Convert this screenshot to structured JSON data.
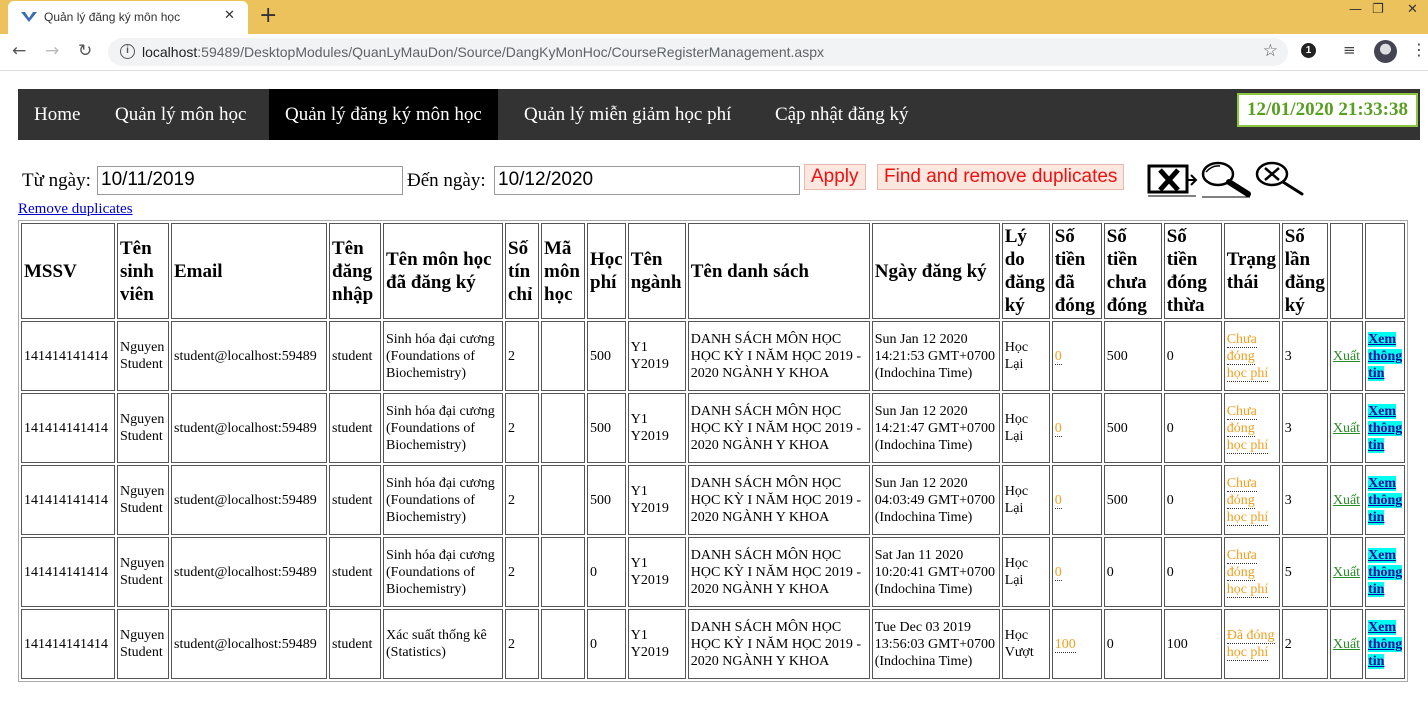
{
  "browser": {
    "tab_title": "Quản lý đăng ký môn học",
    "url_host": "localhost",
    "url_rest": ":59489/DesktopModules/QuanLyMauDon/Source/DangKyMonHoc/CourseRegisterManagement.aspx",
    "extension_badge": "1"
  },
  "nav": {
    "items": [
      "Home",
      "Quản lý môn học",
      "Quản lý đăng ký môn học",
      "Quản lý miễn giảm học phí",
      "Cập nhật đăng ký"
    ],
    "active": "Quản lý đăng ký môn học",
    "clock": "12/01/2020 21:33:38",
    "clock_color": "#5a9e22"
  },
  "filter": {
    "from_label": "Từ ngày:",
    "from_value": "10/11/2019",
    "to_label": "Đến ngày:",
    "to_value": "10/12/2020",
    "apply_label": "Apply",
    "find_remove_label": "Find and remove duplicates",
    "remove_link": "Remove duplicates",
    "icons": [
      "excel-export-icon",
      "search-icon",
      "clear-search-icon"
    ]
  },
  "table": {
    "headers": [
      "MSSV",
      "Tên sinh viên",
      "Email",
      "Tên đăng nhập",
      "Tên môn học đã đăng ký",
      "Số tín chỉ",
      "Mã môn học",
      "Học phí",
      "Tên ngành",
      "Tên danh sách",
      "Ngày đăng ký",
      "Lý do đăng ký",
      "Số tiền đã đóng",
      "Số tiền chưa đóng",
      "Số tiền đóng thừa",
      "Trạng thái",
      "Số lần đăng ký",
      "",
      ""
    ],
    "rows": [
      {
        "mssv": "141414141414",
        "name": "Nguyen Student",
        "email": "student@localhost:59489",
        "login": "student",
        "course": "Sinh hóa đại cương (Foundations of Biochemistry)",
        "credits": "2",
        "code": "",
        "fee": "500",
        "major": "Y1 Y2019",
        "list": "DANH SÁCH MÔN HỌC HỌC KỲ I NĂM HỌC 2019 - 2020 NGÀNH Y KHOA",
        "date": "Sun Jan 12 2020 14:21:53 GMT+0700 (Indochina Time)",
        "reason": "Học Lại",
        "paid": "0",
        "unpaid": "500",
        "overpaid": "0",
        "status": "Chưa đóng học phí",
        "times": "3",
        "export": "Xuất",
        "view": "Xem thông tin"
      },
      {
        "mssv": "141414141414",
        "name": "Nguyen Student",
        "email": "student@localhost:59489",
        "login": "student",
        "course": "Sinh hóa đại cương (Foundations of Biochemistry)",
        "credits": "2",
        "code": "",
        "fee": "500",
        "major": "Y1 Y2019",
        "list": "DANH SÁCH MÔN HỌC HỌC KỲ I NĂM HỌC 2019 - 2020 NGÀNH Y KHOA",
        "date": "Sun Jan 12 2020 14:21:47 GMT+0700 (Indochina Time)",
        "reason": "Học Lại",
        "paid": "0",
        "unpaid": "500",
        "overpaid": "0",
        "status": "Chưa đóng học phí",
        "times": "3",
        "export": "Xuất",
        "view": "Xem thông tin"
      },
      {
        "mssv": "141414141414",
        "name": "Nguyen Student",
        "email": "student@localhost:59489",
        "login": "student",
        "course": "Sinh hóa đại cương (Foundations of Biochemistry)",
        "credits": "2",
        "code": "",
        "fee": "500",
        "major": "Y1 Y2019",
        "list": "DANH SÁCH MÔN HỌC HỌC KỲ I NĂM HỌC 2019 - 2020 NGÀNH Y KHOA",
        "date": "Sun Jan 12 2020 04:03:49 GMT+0700 (Indochina Time)",
        "reason": "Học Lại",
        "paid": "0",
        "unpaid": "500",
        "overpaid": "0",
        "status": "Chưa đóng học phí",
        "times": "3",
        "export": "Xuất",
        "view": "Xem thông tin"
      },
      {
        "mssv": "141414141414",
        "name": "Nguyen Student",
        "email": "student@localhost:59489",
        "login": "student",
        "course": "Sinh hóa đại cương (Foundations of Biochemistry)",
        "credits": "2",
        "code": "",
        "fee": "0",
        "major": "Y1 Y2019",
        "list": "DANH SÁCH MÔN HỌC HỌC KỲ I NĂM HỌC 2019 - 2020 NGÀNH Y KHOA",
        "date": "Sat Jan 11 2020 10:20:41 GMT+0700 (Indochina Time)",
        "reason": "Học Lại",
        "paid": "0",
        "unpaid": "0",
        "overpaid": "0",
        "status": "Chưa đóng học phí",
        "times": "5",
        "export": "Xuất",
        "view": "Xem thông tin"
      },
      {
        "mssv": "141414141414",
        "name": "Nguyen Student",
        "email": "student@localhost:59489",
        "login": "student",
        "course": "Xác suất thống kê (Statistics)",
        "credits": "2",
        "code": "",
        "fee": "0",
        "major": "Y1 Y2019",
        "list": "DANH SÁCH MÔN HỌC HỌC KỲ I NĂM HỌC 2019 - 2020 NGÀNH Y KHOA",
        "date": "Tue Dec 03 2019 13:56:03 GMT+0700 (Indochina Time)",
        "reason": "Học Vượt",
        "paid": "100",
        "unpaid": "0",
        "overpaid": "100",
        "status": "Đã đóng học phí",
        "times": "2",
        "export": "Xuất",
        "view": "Xem thông tin"
      }
    ]
  }
}
